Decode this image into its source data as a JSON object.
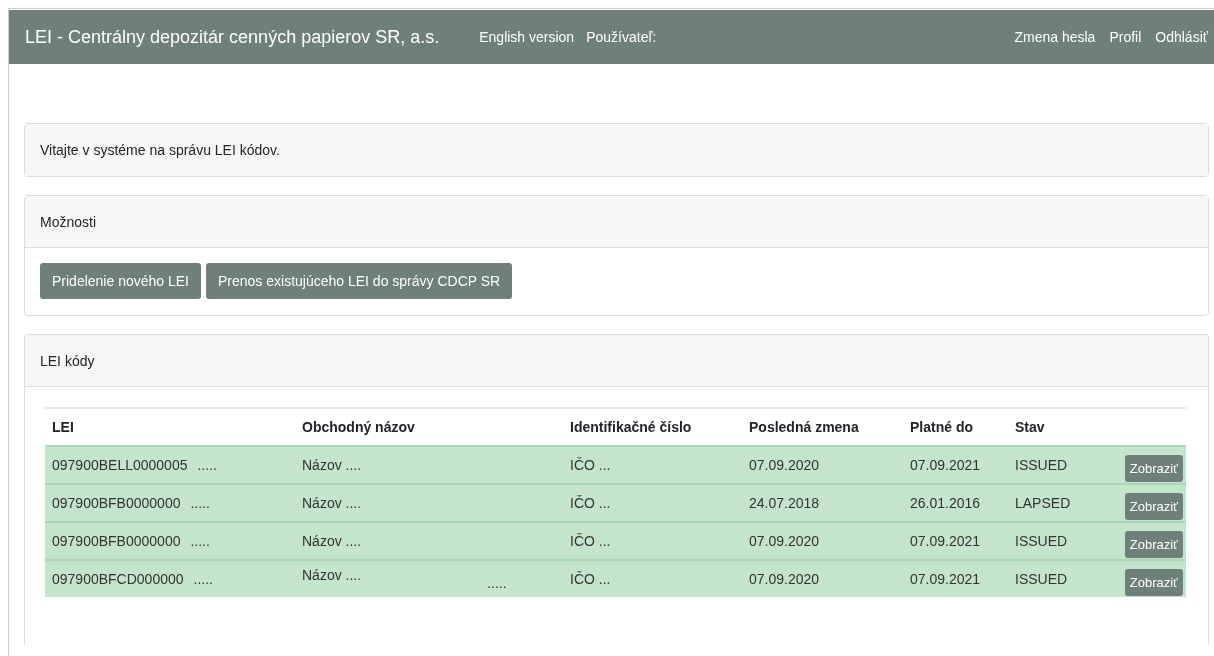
{
  "navbar": {
    "brand": "LEI - Centrálny depozitár cenných papierov SR, a.s.",
    "left_links": [
      "English version",
      "Používateľ:"
    ],
    "right_links": [
      "Zmena hesla",
      "Profil",
      "Odhlásiť"
    ]
  },
  "welcome": {
    "text": "Vitajte v systéme na správu LEI kódov."
  },
  "options": {
    "title": "Možnosti",
    "buttons": [
      "Pridelenie nového LEI",
      "Prenos existujúceho LEI do správy CDCP SR"
    ]
  },
  "lei_codes": {
    "title": "LEI kódy",
    "columns": [
      "LEI",
      "Obchodný názov",
      "Identifikačné číslo",
      "Posledná zmena",
      "Platné do",
      "Stav"
    ],
    "rows": [
      {
        "lei": "097900BELL0000005",
        "lei_note": ".....",
        "name": "Názov ....",
        "id": "IČO ...",
        "changed": "07.09.2020",
        "valid_until": "07.09.2021",
        "status": "ISSUED",
        "action": "Zobraziť"
      },
      {
        "lei": "097900BFB0000000",
        "lei_note": ".....",
        "name": "Názov ....",
        "id": "IČO ...",
        "changed": "24.07.2018",
        "valid_until": "26.01.2016",
        "status": "LAPSED",
        "action": "Zobraziť"
      },
      {
        "lei": "097900BFB0000000",
        "lei_note": ".....",
        "name": "Názov ....",
        "id": "IČO ...",
        "changed": "07.09.2020",
        "valid_until": "07.09.2021",
        "status": "ISSUED",
        "action": "Zobraziť"
      },
      {
        "lei": "097900BFCD000000",
        "lei_note": ".....",
        "name": "Názov ....",
        "name_note": ".....",
        "id": "IČO ...",
        "changed": "07.09.2020",
        "valid_until": "07.09.2021",
        "status": "ISSUED",
        "action": "Zobraziť"
      }
    ]
  }
}
